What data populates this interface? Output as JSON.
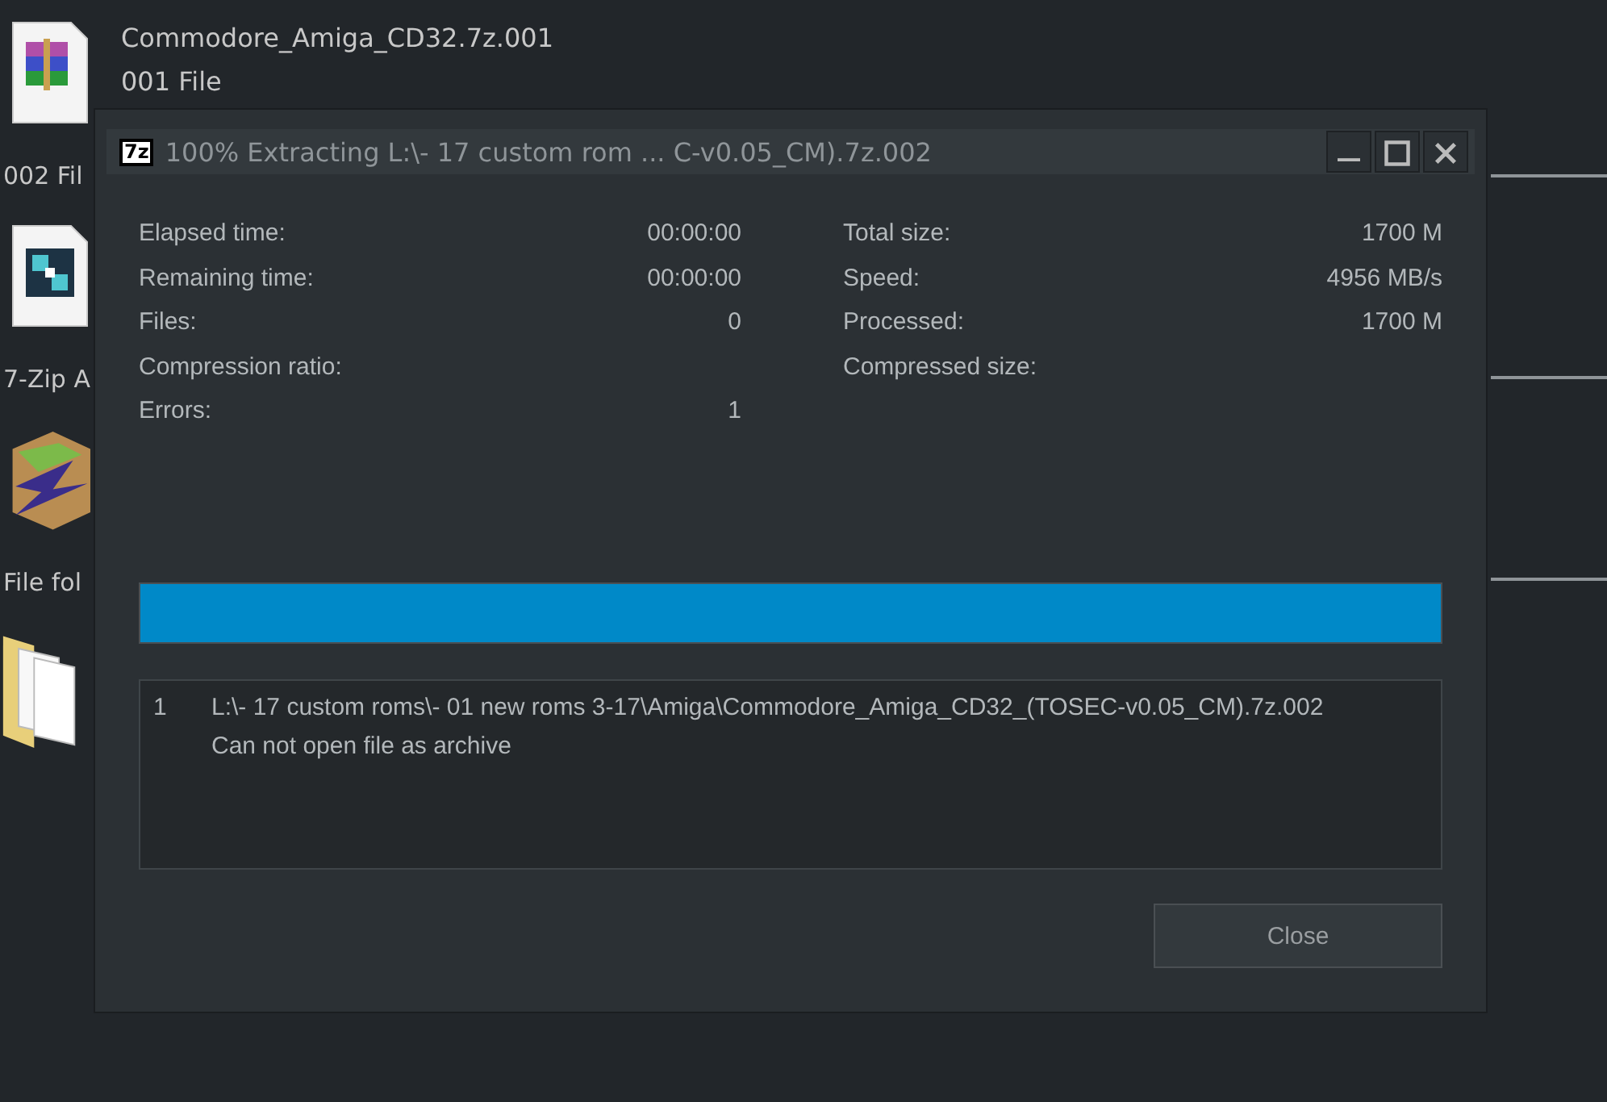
{
  "background_files": {
    "name": "Commodore_Amiga_CD32.7z.001",
    "type": "001 File",
    "strip": [
      {
        "kind": "rar"
      },
      {
        "kind": "label",
        "text": "002 Fil"
      },
      {
        "kind": "sevenzip"
      },
      {
        "kind": "label",
        "text": "7-Zip A"
      },
      {
        "kind": "box"
      },
      {
        "kind": "label",
        "text": "File fol"
      },
      {
        "kind": "folder"
      }
    ]
  },
  "window": {
    "icon": "7z",
    "title": "100% Extracting L:\\- 17 custom rom ... C-v0.05_CM).7z.002"
  },
  "stats_left": [
    {
      "label": "Elapsed time:",
      "value": "00:00:00"
    },
    {
      "label": "Remaining time:",
      "value": "00:00:00"
    },
    {
      "label": "Files:",
      "value": "0"
    },
    {
      "label": "Compression ratio:"
    },
    {
      "label": "Errors:",
      "value": "1"
    }
  ],
  "stats_right": [
    {
      "label": "Total size:",
      "value": "1700 M"
    },
    {
      "label": "Speed:",
      "value": "4956 MB/s"
    },
    {
      "label": "Processed:",
      "value": "1700 M"
    },
    {
      "label": "Compressed size:"
    }
  ],
  "progress": {
    "level": 1
  },
  "log": [
    {
      "index": "1",
      "lines": [
        "L:\\- 17 custom roms\\- 01 new roms 3-17\\Amiga\\Commodore_Amiga_CD32_(TOSEC-v0.05_CM).7z.002",
        "Can not open file as archive"
      ]
    }
  ],
  "buttons": [
    {
      "label": "Close"
    }
  ]
}
